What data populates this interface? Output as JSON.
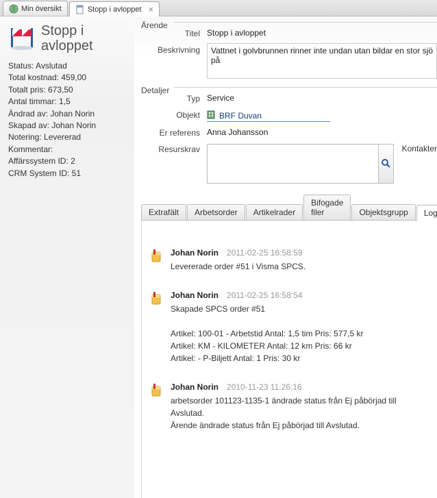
{
  "tabs": {
    "items": [
      {
        "label": "Min översikt",
        "icon": "globe-icon",
        "active": false,
        "closable": false
      },
      {
        "label": "Stopp i avloppet",
        "icon": "note-icon",
        "active": true,
        "closable": true
      }
    ]
  },
  "side": {
    "title": "Stopp i avloppet",
    "lines": [
      "Status: Avslutad",
      "Total kostnad: 459,00",
      "Totalt pris: 673,50",
      "Antal timmar: 1,5",
      "Ändrad av: Johan Norin",
      "Skapad av: Johan Norin",
      "Notering: Levererad",
      "Kommentar:",
      "Affärssystem ID:  2",
      "CRM System ID: 51"
    ]
  },
  "sections": {
    "arende_label": "Ärende",
    "detaljer_label": "Detaljer"
  },
  "fields": {
    "titel_label": "Titel",
    "titel_value": "Stopp i avloppet",
    "beskrivning_label": "Beskrivning",
    "beskrivning_value": "Vattnet i golvbrunnen rinner inte undan utan bildar en stor sjö på",
    "typ_label": "Typ",
    "typ_value": "Service",
    "objekt_label": "Objekt",
    "objekt_value": "BRF Duvan",
    "erreferens_label": "Er referens",
    "erreferens_value": "Anna Johansson",
    "resurskrav_label": "Resurskrav",
    "kontakter_label": "Kontakter"
  },
  "detail_tabs": [
    {
      "label": "Extrafält",
      "active": false
    },
    {
      "label": "Arbetsorder",
      "active": false
    },
    {
      "label": "Artikelrader",
      "active": false
    },
    {
      "label": "Bifogade filer",
      "active": false
    },
    {
      "label": "Objektsgrupp",
      "active": false
    },
    {
      "label": "Logg",
      "active": true
    }
  ],
  "log": [
    {
      "user": "Johan Norin",
      "ts": "2011-02-25 16:58:59",
      "text": "Levererade order #51 i Visma SPCS."
    },
    {
      "user": "Johan Norin",
      "ts": "2011-02-25 16:58:54",
      "text": "Skapade SPCS order #51\n\nArtikel: 100-01 - Arbetstid Antal: 1,5 tim Pris: 577,5 kr\nArtikel: KM - KILOMETER Antal: 12 km Pris: 66 kr\nArtikel:  - P-Biljett Antal: 1  Pris: 30 kr"
    },
    {
      "user": "Johan Norin",
      "ts": "2010-11-23 11:26:16",
      "text": "arbetsorder 101123-1135-1 ändrade status från Ej påbörjad till Avslutad.\nÄrende ändrade status från Ej påbörjad till Avslutad."
    }
  ]
}
